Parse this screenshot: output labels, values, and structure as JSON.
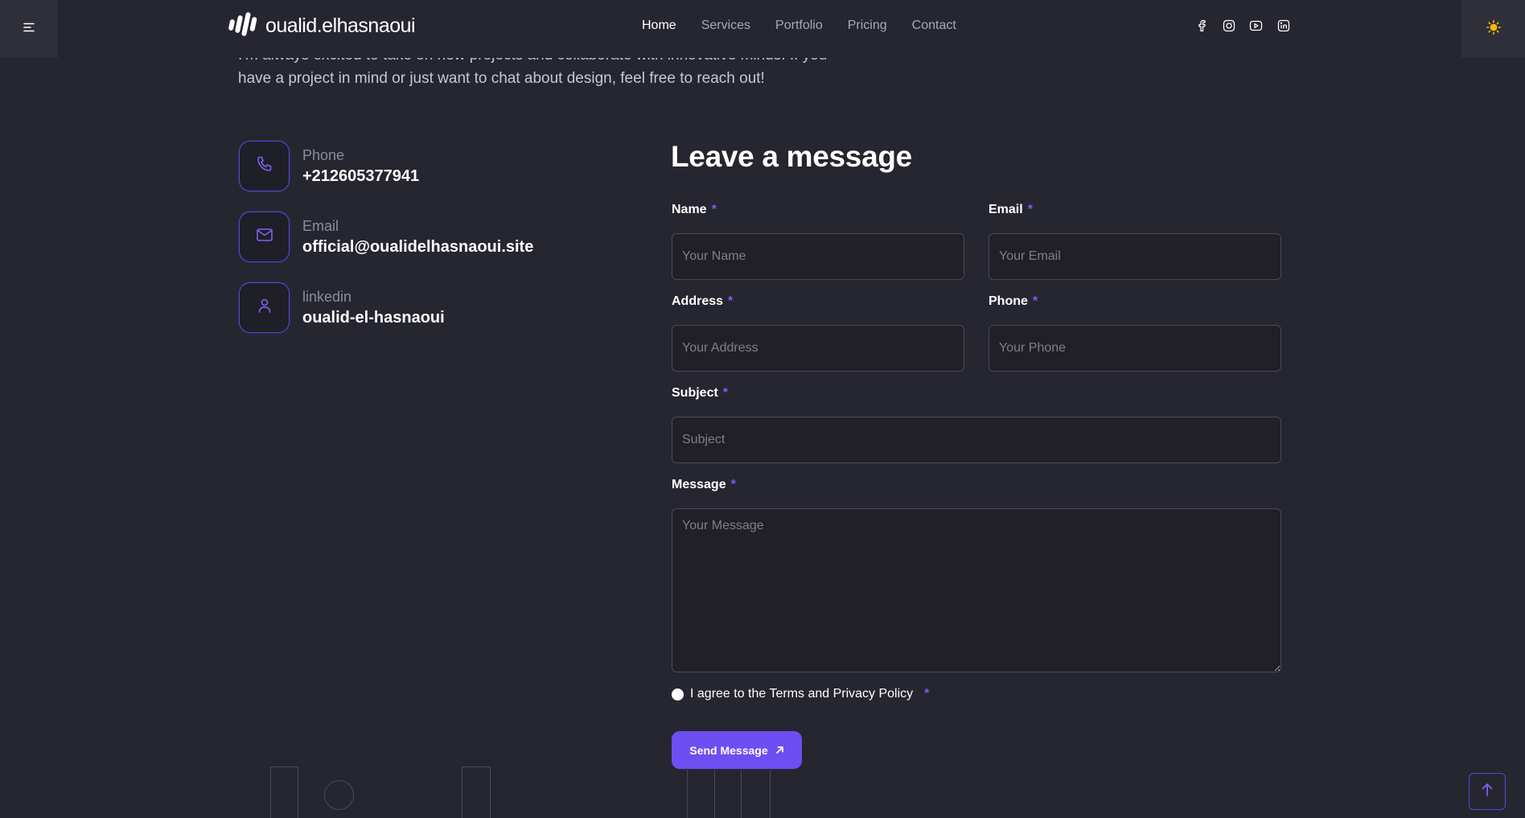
{
  "header": {
    "logo_text": "oualid.elhasnaoui",
    "nav": [
      {
        "label": "Home",
        "active": true
      },
      {
        "label": "Services",
        "active": false
      },
      {
        "label": "Portfolio",
        "active": false
      },
      {
        "label": "Pricing",
        "active": false
      },
      {
        "label": "Contact",
        "active": false
      }
    ],
    "socials": [
      "facebook-icon",
      "instagram-icon",
      "youtube-icon",
      "linkedin-icon"
    ],
    "menu_icon": "menu-icon",
    "theme_icon": "sun-icon"
  },
  "intro": {
    "line1": "I'm always excited to take on new projects and collaborate with innovative minds. If you",
    "line2": "have a project in mind or just want to chat about design, feel free to reach out!"
  },
  "contact_info": [
    {
      "icon": "phone-icon",
      "label": "Phone",
      "value": "+212605377941"
    },
    {
      "icon": "mail-icon",
      "label": "Email",
      "value": "official@oualidelhasnaoui.site"
    },
    {
      "icon": "user-icon",
      "label": "linkedin",
      "value": "oualid-el-hasnaoui"
    }
  ],
  "form": {
    "title": "Leave a message",
    "required_mark": "*",
    "fields": {
      "name": {
        "label": "Name",
        "placeholder": "Your Name",
        "value": ""
      },
      "email": {
        "label": "Email",
        "placeholder": "Your Email",
        "value": ""
      },
      "address": {
        "label": "Address",
        "placeholder": "Your Address",
        "value": ""
      },
      "phone": {
        "label": "Phone",
        "placeholder": "Your Phone",
        "value": ""
      },
      "subject": {
        "label": "Subject",
        "placeholder": "Subject",
        "value": ""
      },
      "message": {
        "label": "Message",
        "placeholder": "Your Message",
        "value": ""
      }
    },
    "agree_text": "I agree to the Terms and Privacy Policy",
    "submit_label": "Send Message"
  },
  "colors": {
    "background": "#262631",
    "accent": "#6d4ef2",
    "border_accent": "#5b47d6",
    "sun": "#f5b800"
  }
}
